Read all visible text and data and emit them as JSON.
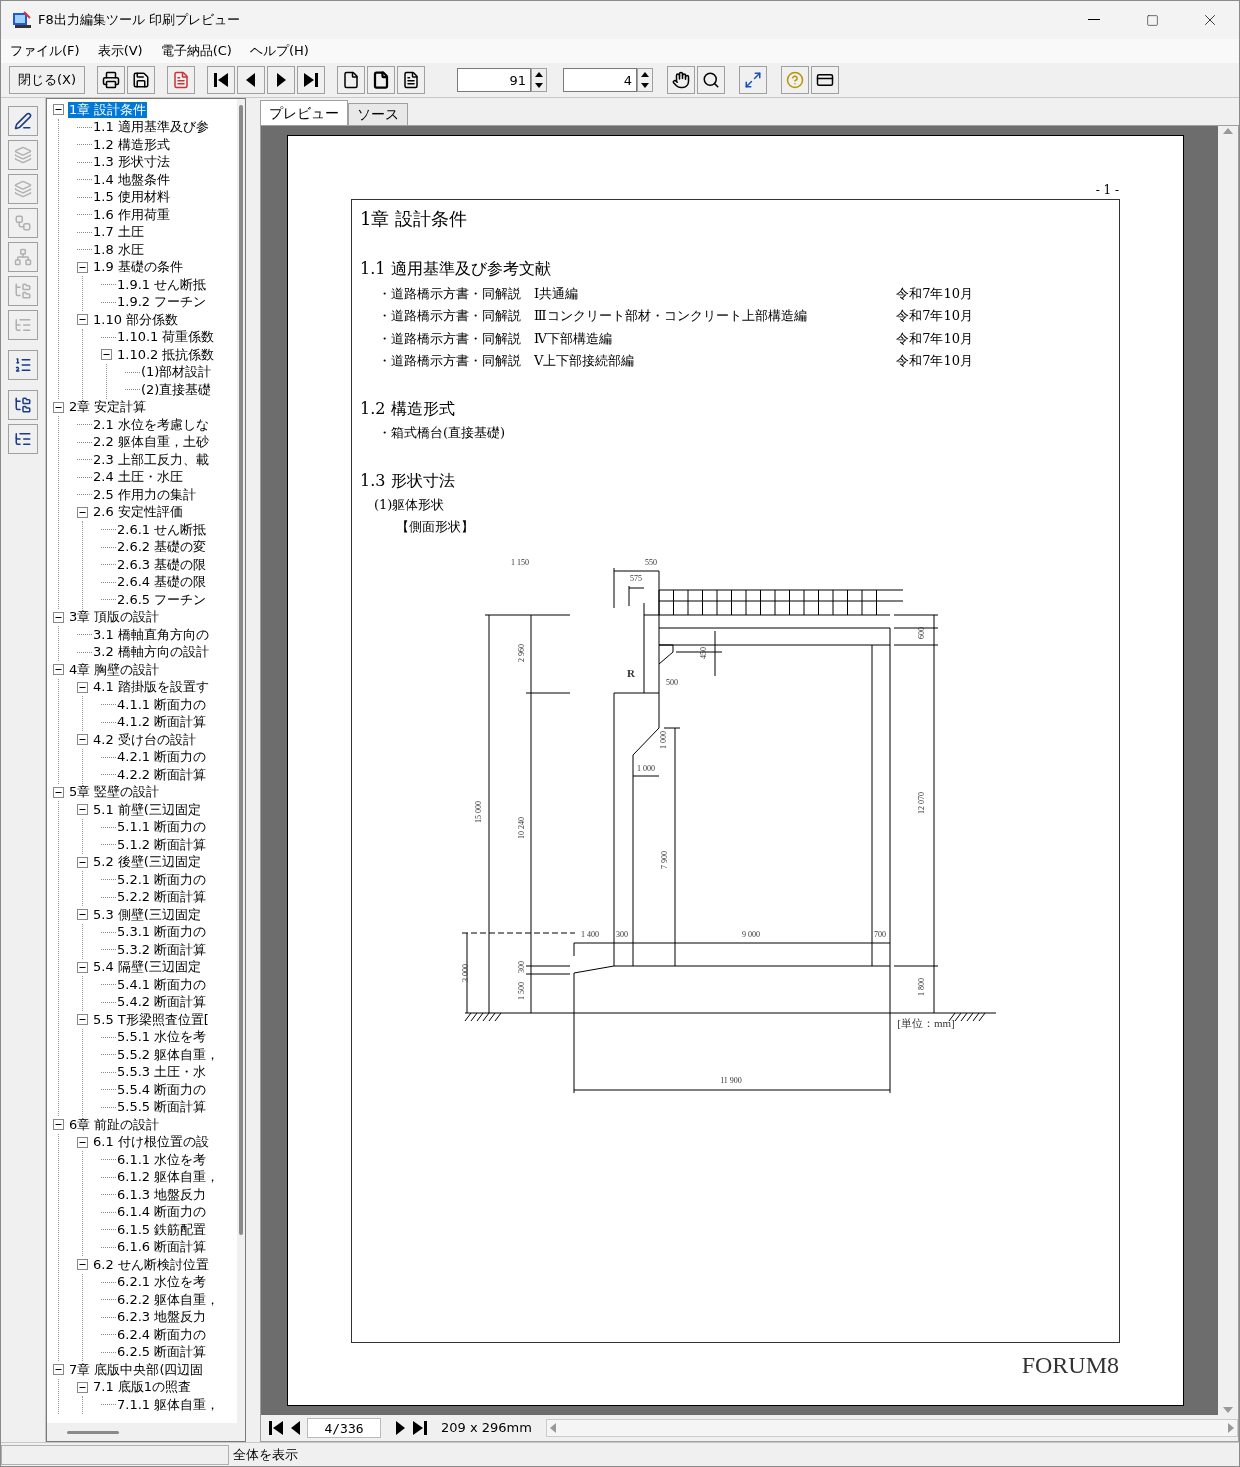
{
  "window": {
    "title": "F8出力編集ツール 印刷プレビュー"
  },
  "menu": [
    "ファイル(F)",
    "表示(V)",
    "電子納品(C)",
    "ヘルプ(H)"
  ],
  "toolbar": {
    "close_label": "閉じる(X)",
    "zoom_value": "91",
    "page_value": "4"
  },
  "side_tools": [
    {
      "disabled": false
    },
    {
      "disabled": true
    },
    {
      "disabled": true
    },
    {
      "disabled": true
    },
    {
      "disabled": true
    },
    {
      "disabled": true
    },
    {
      "disabled": true
    },
    {
      "disabled": false
    },
    {
      "disabled": false
    },
    {
      "disabled": false
    }
  ],
  "tree": [
    {
      "label": "1章 設計条件",
      "selected": true,
      "expanded": true,
      "children": [
        {
          "label": "1.1 適用基準及び参",
          "selected": false
        },
        {
          "label": "1.2 構造形式",
          "selected": false
        },
        {
          "label": "1.3 形状寸法",
          "selected": false
        },
        {
          "label": "1.4 地盤条件",
          "selected": false
        },
        {
          "label": "1.5 使用材料",
          "selected": false
        },
        {
          "label": "1.6 作用荷重",
          "selected": false
        },
        {
          "label": "1.7 土圧",
          "selected": false
        },
        {
          "label": "1.8 水圧",
          "selected": false
        },
        {
          "label": "1.9 基礎の条件",
          "selected": false,
          "expanded": true,
          "children": [
            {
              "label": "1.9.1 せん断抵",
              "selected": false
            },
            {
              "label": "1.9.2 フーチン",
              "selected": false
            }
          ]
        },
        {
          "label": "1.10 部分係数",
          "selected": false,
          "expanded": true,
          "children": [
            {
              "label": "1.10.1 荷重係数",
              "selected": false
            },
            {
              "label": "1.10.2 抵抗係数",
              "selected": false,
              "expanded": true,
              "children": [
                {
                  "label": "(1)部材設計",
                  "selected": false
                },
                {
                  "label": "(2)直接基礎",
                  "selected": false
                }
              ]
            }
          ]
        }
      ]
    },
    {
      "label": "2章 安定計算",
      "selected": false,
      "expanded": true,
      "children": [
        {
          "label": "2.1 水位を考慮しな",
          "selected": false
        },
        {
          "label": "2.2 躯体自重，土砂",
          "selected": false
        },
        {
          "label": "2.3 上部工反力、載",
          "selected": false
        },
        {
          "label": "2.4 土圧・水圧",
          "selected": false
        },
        {
          "label": "2.5 作用力の集計",
          "selected": false
        },
        {
          "label": "2.6 安定性評価",
          "selected": false,
          "expanded": true,
          "children": [
            {
              "label": "2.6.1 せん断抵",
              "selected": false
            },
            {
              "label": "2.6.2 基礎の変",
              "selected": false
            },
            {
              "label": "2.6.3 基礎の限",
              "selected": false
            },
            {
              "label": "2.6.4 基礎の限",
              "selected": false
            },
            {
              "label": "2.6.5 フーチン",
              "selected": false
            }
          ]
        }
      ]
    },
    {
      "label": "3章 頂版の設計",
      "selected": false,
      "expanded": true,
      "children": [
        {
          "label": "3.1 橋軸直角方向の",
          "selected": false
        },
        {
          "label": "3.2 橋軸方向の設計",
          "selected": false
        }
      ]
    },
    {
      "label": "4章 胸壁の設計",
      "selected": false,
      "expanded": true,
      "children": [
        {
          "label": "4.1 踏掛版を設置す",
          "selected": false,
          "expanded": true,
          "children": [
            {
              "label": "4.1.1 断面力の",
              "selected": false
            },
            {
              "label": "4.1.2 断面計算",
              "selected": false
            }
          ]
        },
        {
          "label": "4.2 受け台の設計",
          "selected": false,
          "expanded": true,
          "children": [
            {
              "label": "4.2.1 断面力の",
              "selected": false
            },
            {
              "label": "4.2.2 断面計算",
              "selected": false
            }
          ]
        }
      ]
    },
    {
      "label": "5章 竪壁の設計",
      "selected": false,
      "expanded": true,
      "children": [
        {
          "label": "5.1 前壁(三辺固定",
          "selected": false,
          "expanded": true,
          "children": [
            {
              "label": "5.1.1 断面力の",
              "selected": false
            },
            {
              "label": "5.1.2 断面計算",
              "selected": false
            }
          ]
        },
        {
          "label": "5.2 後壁(三辺固定",
          "selected": false,
          "expanded": true,
          "children": [
            {
              "label": "5.2.1 断面力の",
              "selected": false
            },
            {
              "label": "5.2.2 断面計算",
              "selected": false
            }
          ]
        },
        {
          "label": "5.3 側壁(三辺固定",
          "selected": false,
          "expanded": true,
          "children": [
            {
              "label": "5.3.1 断面力の",
              "selected": false
            },
            {
              "label": "5.3.2 断面計算",
              "selected": false
            }
          ]
        },
        {
          "label": "5.4 隔壁(三辺固定",
          "selected": false,
          "expanded": true,
          "children": [
            {
              "label": "5.4.1 断面力の",
              "selected": false
            },
            {
              "label": "5.4.2 断面計算",
              "selected": false
            }
          ]
        },
        {
          "label": "5.5 T形梁照査位置[",
          "selected": false,
          "expanded": true,
          "children": [
            {
              "label": "5.5.1 水位を考",
              "selected": false
            },
            {
              "label": "5.5.2 躯体自重，",
              "selected": false
            },
            {
              "label": "5.5.3 土圧・水",
              "selected": false
            },
            {
              "label": "5.5.4 断面力の",
              "selected": false
            },
            {
              "label": "5.5.5 断面計算",
              "selected": false
            }
          ]
        }
      ]
    },
    {
      "label": "6章 前趾の設計",
      "selected": false,
      "expanded": true,
      "children": [
        {
          "label": "6.1 付け根位置の設",
          "selected": false,
          "expanded": true,
          "children": [
            {
              "label": "6.1.1 水位を考",
              "selected": false
            },
            {
              "label": "6.1.2 躯体自重，",
              "selected": false
            },
            {
              "label": "6.1.3 地盤反力",
              "selected": false
            },
            {
              "label": "6.1.4 断面力の",
              "selected": false
            },
            {
              "label": "6.1.5 鉄筋配置",
              "selected": false
            },
            {
              "label": "6.1.6 断面計算",
              "selected": false
            }
          ]
        },
        {
          "label": "6.2 せん断検討位置",
          "selected": false,
          "expanded": true,
          "children": [
            {
              "label": "6.2.1 水位を考",
              "selected": false
            },
            {
              "label": "6.2.2 躯体自重，",
              "selected": false
            },
            {
              "label": "6.2.3 地盤反力",
              "selected": false
            },
            {
              "label": "6.2.4 断面力の",
              "selected": false
            },
            {
              "label": "6.2.5 断面計算",
              "selected": false
            }
          ]
        }
      ]
    },
    {
      "label": "7章 底版中央部(四辺固",
      "selected": false,
      "expanded": true,
      "children": [
        {
          "label": "7.1 底版1の照査",
          "selected": false,
          "expanded": true,
          "children": [
            {
              "label": "7.1.1 躯体自重，",
              "selected": false
            }
          ]
        }
      ]
    }
  ],
  "tabs": [
    {
      "label": "プレビュー",
      "selected": true
    },
    {
      "label": "ソース",
      "selected": false
    }
  ],
  "page": {
    "page_number": "- 1 -",
    "chapter_title": "1章 設計条件",
    "sections": [
      {
        "heading": "1.1 適用基準及び参考文献",
        "items": [
          {
            "kind": "reference",
            "text": "・道路橋示方書・同解説　Ⅰ共通編",
            "date": "令和7年10月"
          },
          {
            "kind": "reference",
            "text": "・道路橋示方書・同解説　Ⅲコンクリート部材・コンクリート上部構造編",
            "date": "令和7年10月"
          },
          {
            "kind": "reference",
            "text": "・道路橋示方書・同解説　Ⅳ下部構造編",
            "date": "令和7年10月"
          },
          {
            "kind": "reference",
            "text": "・道路橋示方書・同解説　Ⅴ上下部接続部編",
            "date": "令和7年10月"
          }
        ]
      },
      {
        "heading": "1.2 構造形式",
        "items": [
          {
            "kind": "bullet",
            "text": "・箱式橋台(直接基礎)"
          }
        ]
      },
      {
        "heading": "1.3 形状寸法",
        "items": [
          {
            "kind": "subheading",
            "text": "(1)躯体形状"
          },
          {
            "kind": "caption",
            "text": "【側面形状】"
          },
          {
            "kind": "drawing",
            "labels": [
              "1 150",
              "550",
              "575",
              "R",
              "500",
              "450",
              "2 960",
              "10 240",
              "15 000",
              "1 000",
              "1 000",
              "7 900",
              "12 070",
              "600",
              "1 400",
              "300",
              "9 000",
              "700",
              "300",
              "1 500",
              "3 000",
              "1 800",
              "11 900",
              "[単位：mm]"
            ]
          }
        ]
      }
    ],
    "footer_logo": "FORUM8"
  },
  "nav": {
    "page_field": "4/336",
    "paper_size": "209 x 296mm"
  },
  "status_bar": {
    "message": "全体を表示"
  }
}
